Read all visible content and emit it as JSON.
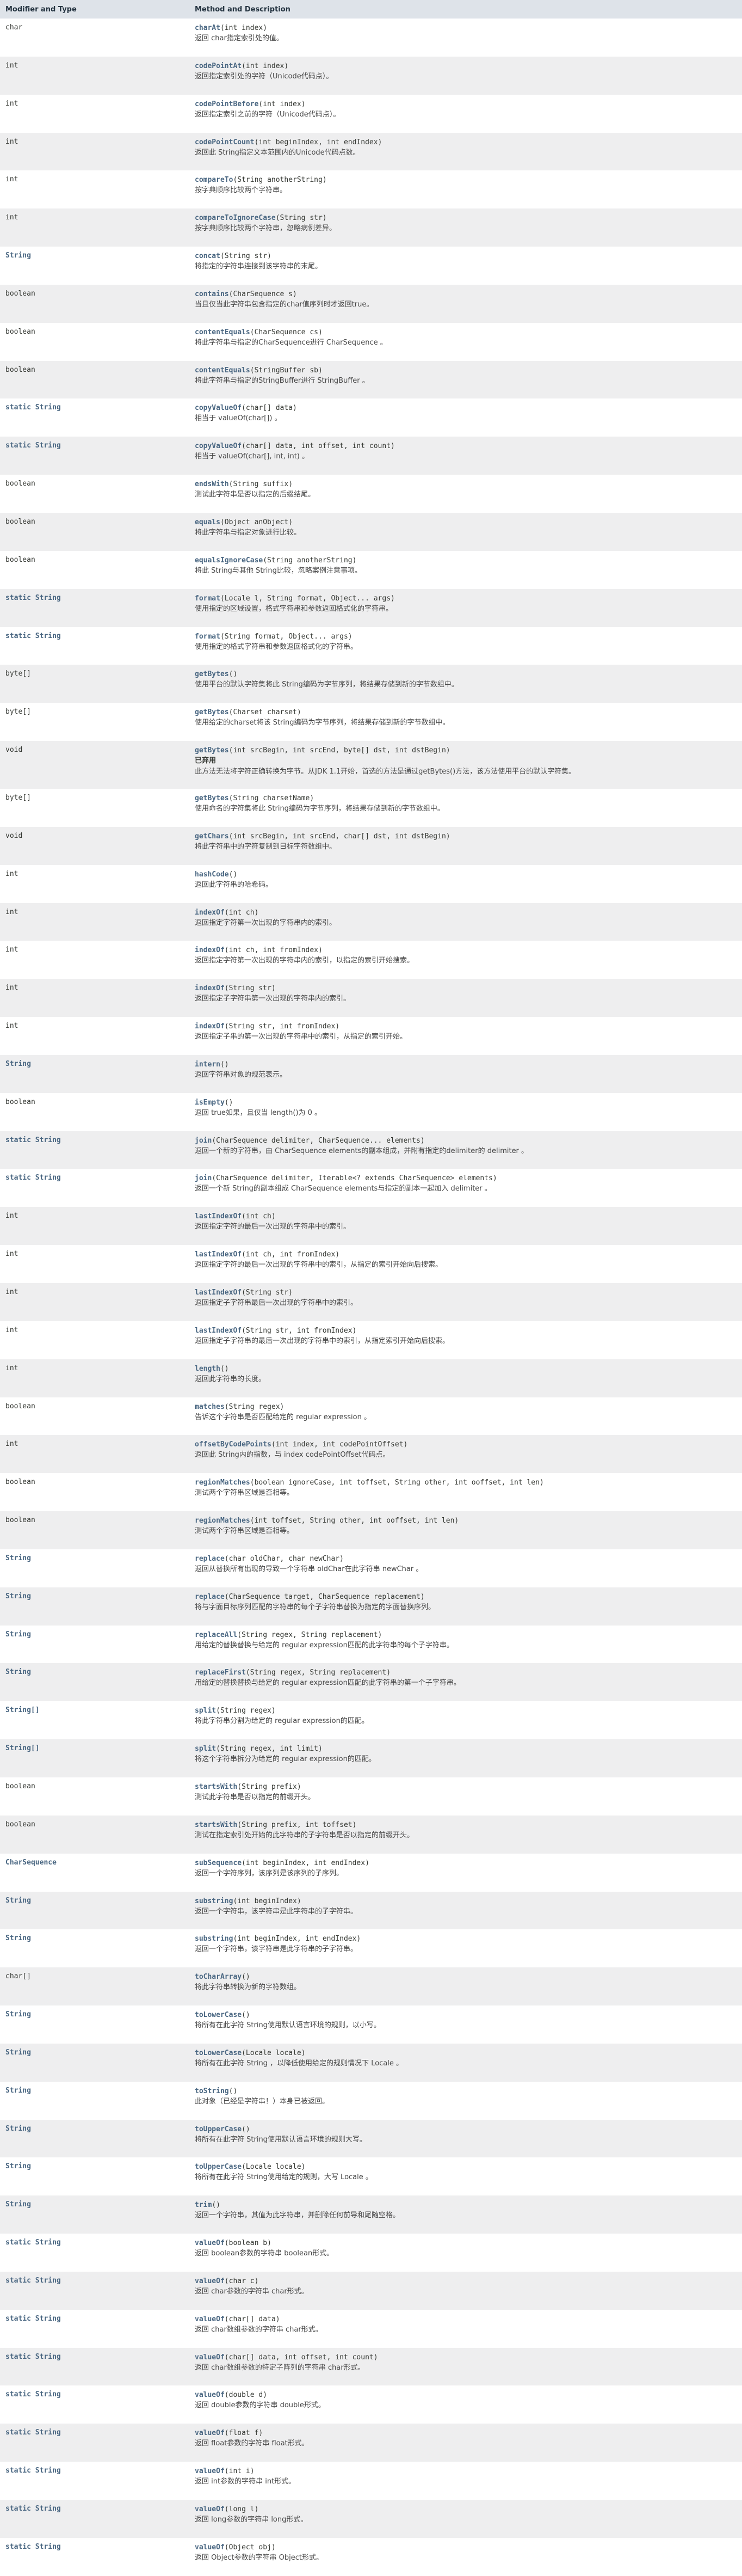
{
  "header": {
    "col1": "Modifier and Type",
    "col2": "Method and Description"
  },
  "rows": [
    {
      "type": "char",
      "type_link": false,
      "name": "charAt",
      "params": "(int index)",
      "desc": "返回 char指定索引处的值。"
    },
    {
      "type": "int",
      "type_link": false,
      "name": "codePointAt",
      "params": "(int index)",
      "desc": "返回指定索引处的字符（Unicode代码点）。"
    },
    {
      "type": "int",
      "type_link": false,
      "name": "codePointBefore",
      "params": "(int index)",
      "desc": "返回指定索引之前的字符（Unicode代码点）。"
    },
    {
      "type": "int",
      "type_link": false,
      "name": "codePointCount",
      "params": "(int beginIndex, int endIndex)",
      "desc": "返回此 String指定文本范围内的Unicode代码点数。"
    },
    {
      "type": "int",
      "type_link": false,
      "name": "compareTo",
      "params": "(String anotherString)",
      "desc": "按字典顺序比较两个字符串。"
    },
    {
      "type": "int",
      "type_link": false,
      "name": "compareToIgnoreCase",
      "params": "(String str)",
      "desc": "按字典顺序比较两个字符串，忽略病例差异。"
    },
    {
      "type": "String",
      "type_link": true,
      "name": "concat",
      "params": "(String str)",
      "desc": "将指定的字符串连接到该字符串的末尾。"
    },
    {
      "type": "boolean",
      "type_link": false,
      "name": "contains",
      "params": "(CharSequence s)",
      "desc": "当且仅当此字符串包含指定的char值序列时才返回true。"
    },
    {
      "type": "boolean",
      "type_link": false,
      "name": "contentEquals",
      "params": "(CharSequence cs)",
      "desc": "将此字符串与指定的CharSequence进行 CharSequence 。"
    },
    {
      "type": "boolean",
      "type_link": false,
      "name": "contentEquals",
      "params": "(StringBuffer sb)",
      "desc": "将此字符串与指定的StringBuffer进行 StringBuffer 。"
    },
    {
      "type": "static String",
      "type_link": true,
      "name": "copyValueOf",
      "params": "(char[] data)",
      "desc": "相当于 valueOf(char[]) 。"
    },
    {
      "type": "static String",
      "type_link": true,
      "name": "copyValueOf",
      "params": "(char[] data, int offset, int count)",
      "desc": "相当于 valueOf(char[], int, int) 。"
    },
    {
      "type": "boolean",
      "type_link": false,
      "name": "endsWith",
      "params": "(String suffix)",
      "desc": "测试此字符串是否以指定的后缀结尾。"
    },
    {
      "type": "boolean",
      "type_link": false,
      "name": "equals",
      "params": "(Object anObject)",
      "desc": "将此字符串与指定对象进行比较。"
    },
    {
      "type": "boolean",
      "type_link": false,
      "name": "equalsIgnoreCase",
      "params": "(String anotherString)",
      "desc": "将此 String与其他 String比较，忽略案例注意事项。"
    },
    {
      "type": "static String",
      "type_link": true,
      "name": "format",
      "params": "(Locale l, String format, Object... args)",
      "desc": "使用指定的区域设置，格式字符串和参数返回格式化的字符串。"
    },
    {
      "type": "static String",
      "type_link": true,
      "name": "format",
      "params": "(String format, Object... args)",
      "desc": "使用指定的格式字符串和参数返回格式化的字符串。"
    },
    {
      "type": "byte[]",
      "type_link": false,
      "name": "getBytes",
      "params": "()",
      "desc": "使用平台的默认字符集将此 String编码为字节序列，将结果存储到新的字节数组中。"
    },
    {
      "type": "byte[]",
      "type_link": false,
      "name": "getBytes",
      "params": "(Charset charset)",
      "desc": "使用给定的charset将该 String编码为字节序列，将结果存储到新的字节数组中。"
    },
    {
      "type": "void",
      "type_link": false,
      "name": "getBytes",
      "params": "(int srcBegin, int srcEnd, byte[] dst, int dstBegin)",
      "deprecated": "已弃用",
      "desc": "此方法无法将字符正确转换为字节。从JDK 1.1开始，首选的方法是通过getBytes()方法，该方法使用平台的默认字符集。"
    },
    {
      "type": "byte[]",
      "type_link": false,
      "name": "getBytes",
      "params": "(String charsetName)",
      "desc": "使用命名的字符集将此 String编码为字节序列，将结果存储到新的字节数组中。"
    },
    {
      "type": "void",
      "type_link": false,
      "name": "getChars",
      "params": "(int srcBegin, int srcEnd, char[] dst, int dstBegin)",
      "desc": "将此字符串中的字符复制到目标字符数组中。"
    },
    {
      "type": "int",
      "type_link": false,
      "name": "hashCode",
      "params": "()",
      "desc": "返回此字符串的哈希码。"
    },
    {
      "type": "int",
      "type_link": false,
      "name": "indexOf",
      "params": "(int ch)",
      "desc": "返回指定字符第一次出现的字符串内的索引。"
    },
    {
      "type": "int",
      "type_link": false,
      "name": "indexOf",
      "params": "(int ch, int fromIndex)",
      "desc": "返回指定字符第一次出现的字符串内的索引，以指定的索引开始搜索。"
    },
    {
      "type": "int",
      "type_link": false,
      "name": "indexOf",
      "params": "(String str)",
      "desc": "返回指定子字符串第一次出现的字符串内的索引。"
    },
    {
      "type": "int",
      "type_link": false,
      "name": "indexOf",
      "params": "(String str, int fromIndex)",
      "desc": "返回指定子串的第一次出现的字符串中的索引，从指定的索引开始。"
    },
    {
      "type": "String",
      "type_link": true,
      "name": "intern",
      "params": "()",
      "desc": "返回字符串对象的规范表示。"
    },
    {
      "type": "boolean",
      "type_link": false,
      "name": "isEmpty",
      "params": "()",
      "desc": "返回 true如果，且仅当 length()为 0 。"
    },
    {
      "type": "static String",
      "type_link": true,
      "name": "join",
      "params": "(CharSequence delimiter, CharSequence... elements)",
      "desc": "返回一个新的字符串，由 CharSequence elements的副本组成，并附有指定的delimiter的 delimiter 。"
    },
    {
      "type": "static String",
      "type_link": true,
      "name": "join",
      "params": "(CharSequence delimiter, Iterable<? extends CharSequence> elements)",
      "desc": "返回一个新 String的副本组成 CharSequence elements与指定的副本一起加入 delimiter 。"
    },
    {
      "type": "int",
      "type_link": false,
      "name": "lastIndexOf",
      "params": "(int ch)",
      "desc": "返回指定字符的最后一次出现的字符串中的索引。"
    },
    {
      "type": "int",
      "type_link": false,
      "name": "lastIndexOf",
      "params": "(int ch, int fromIndex)",
      "desc": "返回指定字符的最后一次出现的字符串中的索引，从指定的索引开始向后搜索。"
    },
    {
      "type": "int",
      "type_link": false,
      "name": "lastIndexOf",
      "params": "(String str)",
      "desc": "返回指定子字符串最后一次出现的字符串中的索引。"
    },
    {
      "type": "int",
      "type_link": false,
      "name": "lastIndexOf",
      "params": "(String str, int fromIndex)",
      "desc": "返回指定子字符串的最后一次出现的字符串中的索引，从指定索引开始向后搜索。"
    },
    {
      "type": "int",
      "type_link": false,
      "name": "length",
      "params": "()",
      "desc": "返回此字符串的长度。"
    },
    {
      "type": "boolean",
      "type_link": false,
      "name": "matches",
      "params": "(String regex)",
      "desc": "告诉这个字符串是否匹配给定的 regular expression 。"
    },
    {
      "type": "int",
      "type_link": false,
      "name": "offsetByCodePoints",
      "params": "(int index, int codePointOffset)",
      "desc": "返回此 String内的指数，与 index codePointOffset代码点。"
    },
    {
      "type": "boolean",
      "type_link": false,
      "name": "regionMatches",
      "params": "(boolean ignoreCase, int toffset, String other, int ooffset, int len)",
      "desc": "测试两个字符串区域是否相等。"
    },
    {
      "type": "boolean",
      "type_link": false,
      "name": "regionMatches",
      "params": "(int toffset, String other, int ooffset, int len)",
      "desc": "测试两个字符串区域是否相等。"
    },
    {
      "type": "String",
      "type_link": true,
      "name": "replace",
      "params": "(char oldChar, char newChar)",
      "desc": "返回从替换所有出现的导致一个字符串 oldChar在此字符串 newChar 。"
    },
    {
      "type": "String",
      "type_link": true,
      "name": "replace",
      "params": "(CharSequence target, CharSequence replacement)",
      "desc": "将与字面目标序列匹配的字符串的每个子字符串替换为指定的字面替换序列。"
    },
    {
      "type": "String",
      "type_link": true,
      "name": "replaceAll",
      "params": "(String regex, String replacement)",
      "desc": "用给定的替换替换与给定的 regular expression匹配的此字符串的每个子字符串。"
    },
    {
      "type": "String",
      "type_link": true,
      "name": "replaceFirst",
      "params": "(String regex, String replacement)",
      "desc": "用给定的替换替换与给定的 regular expression匹配的此字符串的第一个子字符串。"
    },
    {
      "type": "String[]",
      "type_link": true,
      "name": "split",
      "params": "(String regex)",
      "desc": "将此字符串分割为给定的 regular expression的匹配。"
    },
    {
      "type": "String[]",
      "type_link": true,
      "name": "split",
      "params": "(String regex, int limit)",
      "desc": "将这个字符串拆分为给定的 regular expression的匹配。"
    },
    {
      "type": "boolean",
      "type_link": false,
      "name": "startsWith",
      "params": "(String prefix)",
      "desc": "测试此字符串是否以指定的前缀开头。"
    },
    {
      "type": "boolean",
      "type_link": false,
      "name": "startsWith",
      "params": "(String prefix, int toffset)",
      "desc": "测试在指定索引处开始的此字符串的子字符串是否以指定的前缀开头。"
    },
    {
      "type": "CharSequence",
      "type_link": true,
      "name": "subSequence",
      "params": "(int beginIndex, int endIndex)",
      "desc": "返回一个字符序列，该序列是该序列的子序列。"
    },
    {
      "type": "String",
      "type_link": true,
      "name": "substring",
      "params": "(int beginIndex)",
      "desc": "返回一个字符串，该字符串是此字符串的子字符串。"
    },
    {
      "type": "String",
      "type_link": true,
      "name": "substring",
      "params": "(int beginIndex, int endIndex)",
      "desc": "返回一个字符串，该字符串是此字符串的子字符串。"
    },
    {
      "type": "char[]",
      "type_link": false,
      "name": "toCharArray",
      "params": "()",
      "desc": "将此字符串转换为新的字符数组。"
    },
    {
      "type": "String",
      "type_link": true,
      "name": "toLowerCase",
      "params": "()",
      "desc": "将所有在此字符 String使用默认语言环境的规则，以小写。"
    },
    {
      "type": "String",
      "type_link": true,
      "name": "toLowerCase",
      "params": "(Locale locale)",
      "desc": "将所有在此字符 String ，以降低使用给定的规则情况下 Locale 。"
    },
    {
      "type": "String",
      "type_link": true,
      "name": "toString",
      "params": "()",
      "desc": "此对象（已经是字符串！）本身已被返回。"
    },
    {
      "type": "String",
      "type_link": true,
      "name": "toUpperCase",
      "params": "()",
      "desc": "将所有在此字符 String使用默认语言环境的规则大写。"
    },
    {
      "type": "String",
      "type_link": true,
      "name": "toUpperCase",
      "params": "(Locale locale)",
      "desc": "将所有在此字符 String使用给定的规则，大写 Locale 。"
    },
    {
      "type": "String",
      "type_link": true,
      "name": "trim",
      "params": "()",
      "desc": "返回一个字符串，其值为此字符串，并删除任何前导和尾随空格。"
    },
    {
      "type": "static String",
      "type_link": true,
      "name": "valueOf",
      "params": "(boolean b)",
      "desc": "返回 boolean参数的字符串 boolean形式。"
    },
    {
      "type": "static String",
      "type_link": true,
      "name": "valueOf",
      "params": "(char c)",
      "desc": "返回 char参数的字符串 char形式。"
    },
    {
      "type": "static String",
      "type_link": true,
      "name": "valueOf",
      "params": "(char[] data)",
      "desc": "返回 char数组参数的字符串 char形式。"
    },
    {
      "type": "static String",
      "type_link": true,
      "name": "valueOf",
      "params": "(char[] data, int offset, int count)",
      "desc": "返回 char数组参数的特定子阵列的字符串 char形式。"
    },
    {
      "type": "static String",
      "type_link": true,
      "name": "valueOf",
      "params": "(double d)",
      "desc": "返回 double参数的字符串 double形式。"
    },
    {
      "type": "static String",
      "type_link": true,
      "name": "valueOf",
      "params": "(float f)",
      "desc": "返回 float参数的字符串 float形式。"
    },
    {
      "type": "static String",
      "type_link": true,
      "name": "valueOf",
      "params": "(int i)",
      "desc": "返回 int参数的字符串 int形式。"
    },
    {
      "type": "static String",
      "type_link": true,
      "name": "valueOf",
      "params": "(long l)",
      "desc": "返回 long参数的字符串 long形式。"
    },
    {
      "type": "static String",
      "type_link": true,
      "name": "valueOf",
      "params": "(Object obj)",
      "desc": "返回 Object参数的字符串 Object形式。"
    }
  ]
}
